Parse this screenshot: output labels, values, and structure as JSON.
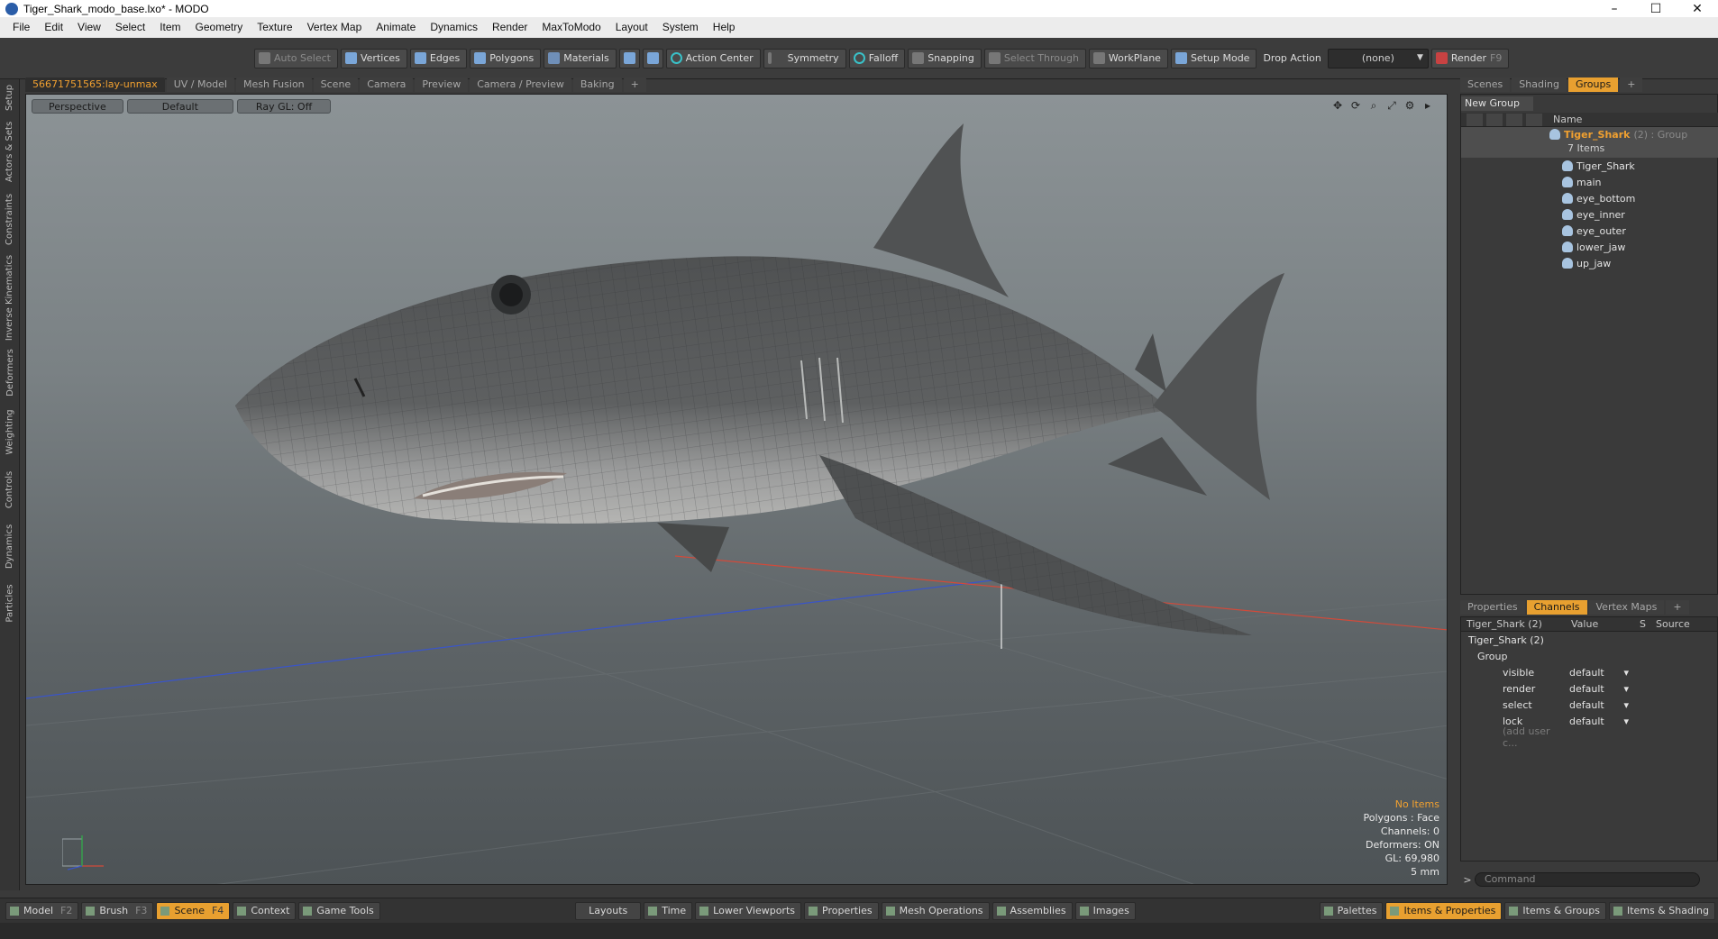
{
  "window": {
    "title": "Tiger_Shark_modo_base.lxo* - MODO",
    "min_label": "–",
    "max_label": "☐",
    "close_label": "✕"
  },
  "menu": [
    "File",
    "Edit",
    "View",
    "Select",
    "Item",
    "Geometry",
    "Texture",
    "Vertex Map",
    "Animate",
    "Dynamics",
    "Render",
    "MaxToModo",
    "Layout",
    "System",
    "Help"
  ],
  "toolbar": {
    "auto_select": "Auto Select",
    "vertices": "Vertices",
    "edges": "Edges",
    "polygons": "Polygons",
    "materials": "Materials",
    "action_center": "Action Center",
    "symmetry": "Symmetry",
    "falloff": "Falloff",
    "snapping": "Snapping",
    "select_through": "Select Through",
    "workplane": "WorkPlane",
    "setup_mode": "Setup Mode",
    "drop_action": "Drop Action",
    "drop_value": "(none)",
    "render": "Render",
    "render_key": "F9"
  },
  "vtabs": [
    "Setup",
    "Actors & Sets",
    "Constraints",
    "Inverse Kinematics",
    "Deformers",
    "Weighting",
    "Controls",
    "Dynamics",
    "Particles"
  ],
  "viewport_tabs": [
    "56671751565:lay-unmax",
    "UV / Model",
    "Mesh Fusion",
    "Scene",
    "Camera",
    "Preview",
    "Camera / Preview",
    "Baking",
    "+"
  ],
  "viewport": {
    "view": "Perspective",
    "shading": "Default",
    "raygl": "Ray GL: Off",
    "info": {
      "warn": "No Items",
      "polygons": "Polygons : Face",
      "channels": "Channels: 0",
      "deformers": "Deformers: ON",
      "gl": "GL: 69,980",
      "scale": "5 mm"
    }
  },
  "right_tabs": [
    "Scenes",
    "Shading",
    "Groups",
    "+"
  ],
  "groups": {
    "new_group": "New Group",
    "col_name": "Name",
    "group_name": "Tiger_Shark",
    "group_sub": "(2) : Group",
    "count": "7 Items",
    "items": [
      "Tiger_Shark",
      "main",
      "eye_bottom",
      "eye_inner",
      "eye_outer",
      "lower_jaw",
      "up_jaw"
    ]
  },
  "props_tabs": [
    "Properties",
    "Channels",
    "Vertex Maps",
    "+"
  ],
  "channels": {
    "col_item": "Tiger_Shark (2)",
    "col_value": "Value",
    "col_s": "S",
    "col_source": "Source",
    "root": "Tiger_Shark (2)",
    "group": "Group",
    "rows": [
      {
        "name": "visible",
        "value": "default"
      },
      {
        "name": "render",
        "value": "default"
      },
      {
        "name": "select",
        "value": "default"
      },
      {
        "name": "lock",
        "value": "default"
      }
    ],
    "add": "(add user c..."
  },
  "command": {
    "prompt": ">",
    "placeholder": "Command"
  },
  "bottom": {
    "model": "Model",
    "model_key": "F2",
    "brush": "Brush",
    "brush_key": "F3",
    "scene": "Scene",
    "scene_key": "F4",
    "context": "Context",
    "game_tools": "Game Tools",
    "layouts": "Layouts",
    "time": "Time",
    "lower_viewports": "Lower Viewports",
    "properties": "Properties",
    "mesh_operations": "Mesh Operations",
    "assemblies": "Assemblies",
    "images": "Images",
    "palettes": "Palettes",
    "items_properties": "Items & Properties",
    "items_groups": "Items & Groups",
    "items_shading": "Items & Shading"
  },
  "colors": {
    "accent": "#e8a030",
    "warn_text": "#f0a030"
  }
}
